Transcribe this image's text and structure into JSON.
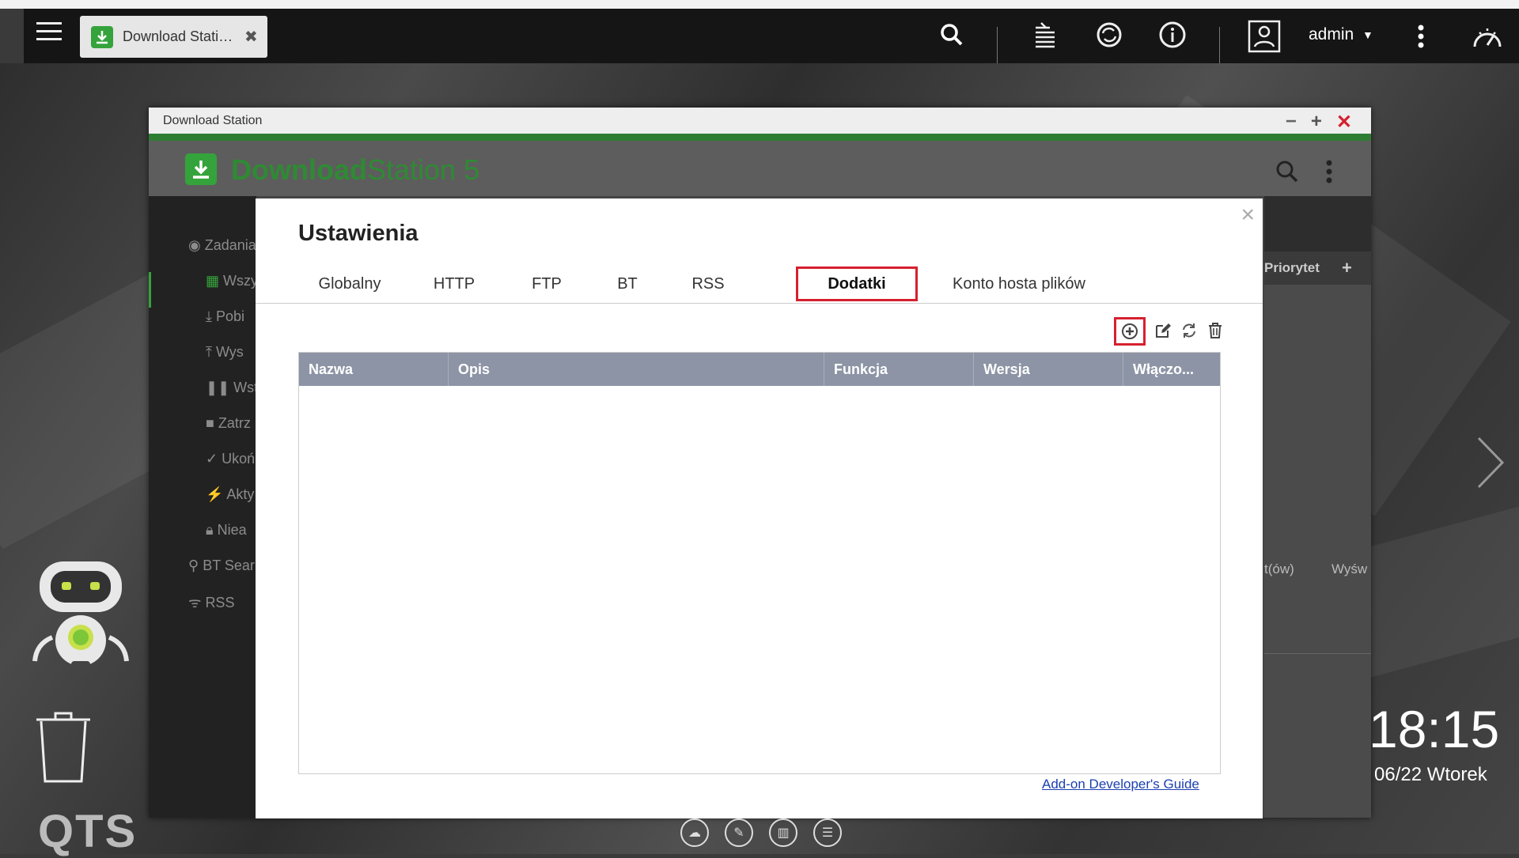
{
  "taskbar": {
    "app_tab_label": "Download Stati…",
    "user": "admin"
  },
  "window": {
    "title": "Download Station",
    "app_name_bold": "Download",
    "app_name_rest": "Station 5"
  },
  "sidebar": {
    "items": [
      "Zadania",
      "Wszy",
      "Pobi",
      "Wys",
      "Wstr",
      "Zatrz",
      "Ukoń",
      "Akty",
      "Niea",
      "BT Sear",
      "RSS"
    ]
  },
  "right_panel": {
    "col_label": "Priorytet",
    "add_label": "+",
    "footer_left": "t(ów)",
    "footer_right": "Wyśw"
  },
  "modal": {
    "title": "Ustawienia",
    "tabs": [
      "Globalny",
      "HTTP",
      "FTP",
      "BT",
      "RSS",
      "Dodatki",
      "Konto hosta plików"
    ],
    "active_tab": "Dodatki",
    "table_columns": [
      "Nazwa",
      "Opis",
      "Funkcja",
      "Wersja",
      "Włączo..."
    ],
    "rows": [],
    "link": "Add-on Developer's Guide"
  },
  "desktop": {
    "time": "18:15",
    "date": "06/22 Wtorek",
    "os_label": "QTS"
  },
  "colors": {
    "accent_green": "#35a33b",
    "highlight_red": "#d6202f",
    "table_header": "#8c94a5"
  }
}
